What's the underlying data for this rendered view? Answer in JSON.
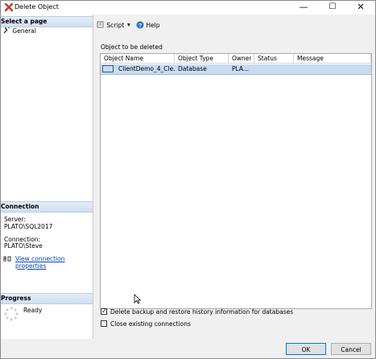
{
  "window": {
    "title": "Delete Object",
    "controls": {
      "minimize": "—",
      "maximize": "☐",
      "close": "✕"
    }
  },
  "sidebar": {
    "select_page_heading": "Select a page",
    "nav_items": [
      {
        "label": "General",
        "icon": "wrench-icon"
      }
    ],
    "connection_heading": "Connection",
    "server_label": "Server:",
    "server_value": "PLATO\\SQL2017",
    "connection_label": "Connection:",
    "connection_value": "PLATO\\Steve",
    "view_props_link": "View connection properties",
    "progress_heading": "Progress",
    "progress_status": "Ready"
  },
  "toolbar": {
    "script_label": "Script",
    "help_label": "Help"
  },
  "objects_section": {
    "label": "Object to be deleted",
    "columns": [
      "Object Name",
      "Object Type",
      "Owner",
      "Status",
      "Message"
    ],
    "rows": [
      {
        "object_name": "ClientDemo_4_Cle...",
        "object_type": "Database",
        "owner": "PLA...",
        "status": "",
        "message": ""
      }
    ]
  },
  "options": {
    "delete_backup_label": "Delete backup and restore history information for databases",
    "delete_backup_checked": true,
    "close_connections_label": "Close existing connections",
    "close_connections_checked": false
  },
  "footer": {
    "ok_label": "OK",
    "cancel_label": "Cancel"
  },
  "colors": {
    "selection": "#c7dcf2",
    "link": "#0645ad",
    "section_header": "#dce8f5",
    "delete_x": "#c0392b"
  }
}
